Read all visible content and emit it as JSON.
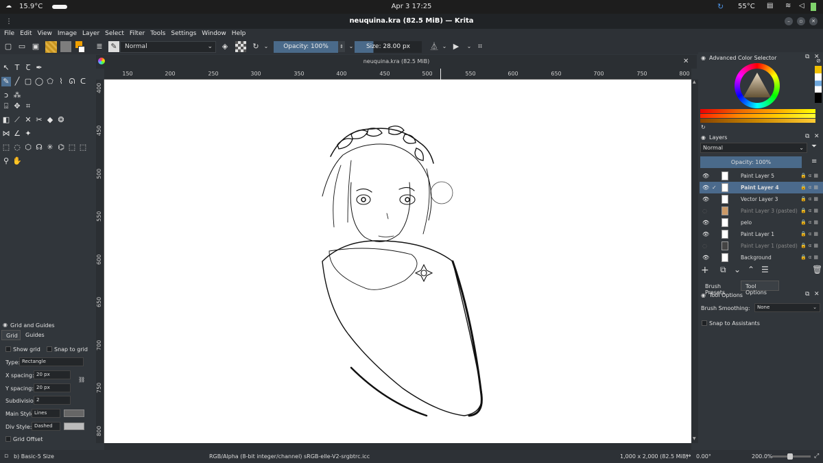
{
  "system": {
    "temperature": "15.9°C",
    "datetime": "Apr 3  17:25",
    "cpu_temp": "55°C"
  },
  "window": {
    "title": "neuquina.kra (82.5 MiB) — Krita"
  },
  "menu": [
    "File",
    "Edit",
    "View",
    "Image",
    "Layer",
    "Select",
    "Filter",
    "Tools",
    "Settings",
    "Window",
    "Help"
  ],
  "toolbar": {
    "blend_mode": "Normal",
    "opacity": "Opacity: 100%",
    "size": "Size: 28.00 px"
  },
  "document": {
    "tab_title": "neuquina.kra (82.5 MiB)"
  },
  "rulers": {
    "h": [
      "150",
      "200",
      "250",
      "300",
      "350",
      "400",
      "450",
      "500",
      "550",
      "600",
      "650",
      "700",
      "750",
      "800"
    ],
    "v": [
      "400",
      "450",
      "500",
      "550",
      "600",
      "650",
      "700",
      "750",
      "800"
    ]
  },
  "grid_docker": {
    "title": "Grid and Guides",
    "tabs": [
      "Grid",
      "Guides"
    ],
    "show_grid": "Show grid",
    "snap_to_grid": "Snap to grid",
    "type_label": "Type:",
    "type_value": "Rectangle",
    "x_label": "X spacing:",
    "x_value": "20 px",
    "y_label": "Y spacing:",
    "y_value": "20 px",
    "sub_label": "Subdivision:",
    "sub_value": "2",
    "main_label": "Main Style:",
    "main_value": "Lines",
    "div_label": "Div Style:",
    "div_value": "Dashed",
    "offset": "Grid Offset"
  },
  "color_docker": {
    "title": "Advanced Color Selector"
  },
  "layers_docker": {
    "title": "Layers",
    "blend": "Normal",
    "opacity": "Opacity:  100%",
    "layers": [
      {
        "name": "Paint Layer 5",
        "visible": true
      },
      {
        "name": "Paint Layer 4",
        "visible": true,
        "active": true
      },
      {
        "name": "Vector Layer 3",
        "visible": true
      },
      {
        "name": "Paint Layer 3 (pasted)",
        "visible": false
      },
      {
        "name": "pelo",
        "visible": true
      },
      {
        "name": "Paint Layer 1",
        "visible": true
      },
      {
        "name": "Paint Layer 1 (pasted)",
        "visible": false
      },
      {
        "name": "Background",
        "visible": true
      }
    ]
  },
  "tool_options": {
    "tabs": [
      "Brush Presets",
      "Tool Options"
    ],
    "title": "Tool Options",
    "smoothing_label": "Brush Smoothing:",
    "smoothing_value": "None",
    "snap": "Snap to Assistants"
  },
  "status": {
    "brush": "b) Basic-5 Size",
    "color": "RGB/Alpha (8-bit integer/channel)  sRGB-elle-V2-srgbtrc.icc",
    "dims": "1,000 x 2,000 (82.5 MiB)",
    "rotation": "0.00°",
    "zoom": "200.0%"
  }
}
